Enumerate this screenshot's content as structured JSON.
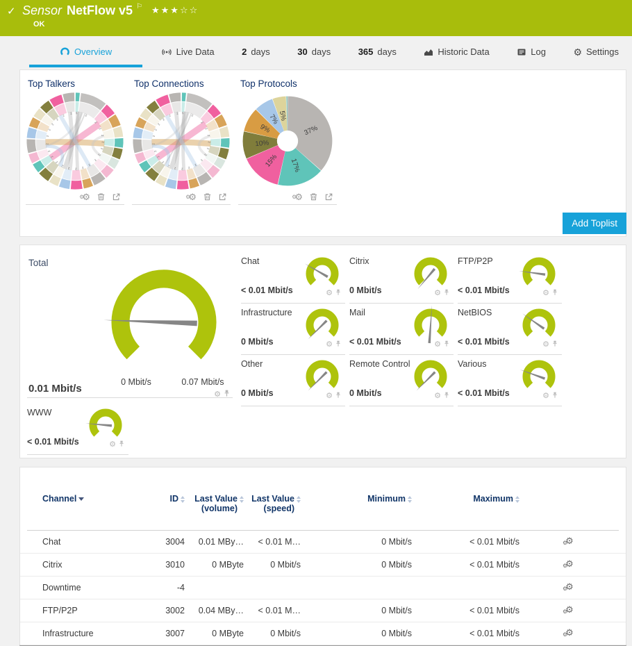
{
  "header": {
    "status_check_icon": "✓",
    "type_label": "Sensor",
    "sensor_name": "NetFlow v5",
    "flag_icon": "⚐",
    "rating_stars": "★★★☆☆",
    "status": "OK",
    "status_color": "#a8bd0c"
  },
  "tabs": [
    {
      "label": "Overview",
      "icon": "gauge-icon",
      "active": true
    },
    {
      "label": "Live Data",
      "icon": "live-data-icon"
    },
    {
      "num": "2",
      "label": "days"
    },
    {
      "num": "30",
      "label": "days"
    },
    {
      "num": "365",
      "label": "days"
    },
    {
      "label": "Historic Data",
      "icon": "area-chart-icon"
    },
    {
      "label": "Log",
      "icon": "log-icon"
    },
    {
      "label": "Settings",
      "icon": "gear-icon"
    }
  ],
  "toplists": {
    "add_button_label": "Add Toplist",
    "chart_action_icons": [
      "settings-gears-icon",
      "trash-icon",
      "open-external-icon"
    ]
  },
  "chart_data": {
    "toplist_charts": [
      {
        "title": "Top Talkers",
        "type": "chord"
      },
      {
        "title": "Top Connections",
        "type": "chord"
      },
      {
        "title": "Top Protocols",
        "type": "donut"
      }
    ],
    "ring_segments": [
      {
        "c": "#5fc4b9",
        "s": 0.5,
        "t": "5"
      },
      {
        "c": "#c2c0be",
        "s": 2.6,
        "t": "2"
      },
      {
        "c": "#f0609f",
        "s": 1.2,
        "t": "2"
      },
      {
        "c": "#d8a45a",
        "s": 1.2,
        "t": "2"
      },
      {
        "c": "#e9e2c6",
        "s": 1.1,
        "t": "2"
      },
      {
        "c": "#5fc4b9",
        "s": 1.0,
        "t": "2"
      },
      {
        "c": "#837f3e",
        "s": 1.1,
        "t": "2"
      },
      {
        "c": "#d9e6df",
        "s": 1.0,
        "t": "2"
      },
      {
        "c": "#f4b8d1",
        "s": 1.1,
        "t": "2"
      },
      {
        "c": "#b8b5b2",
        "s": 1.3,
        "t": "2"
      },
      {
        "c": "#d8a45a",
        "s": 1.0,
        "t": "2"
      },
      {
        "c": "#f0609f",
        "s": 1.2,
        "t": "2"
      },
      {
        "c": "#a7c7e8",
        "s": 1.1,
        "t": "2"
      },
      {
        "c": "#e9e2c6",
        "s": 1.0,
        "t": "2"
      },
      {
        "c": "#837f3e",
        "s": 1.2,
        "t": "2"
      },
      {
        "c": "#5fc4b9",
        "s": 1.0,
        "t": "2"
      },
      {
        "c": "#f4b8d1",
        "s": 1.0,
        "t": "2"
      },
      {
        "c": "#b8b5b2",
        "s": 1.4,
        "t": "2"
      },
      {
        "c": "#a7c7e8",
        "s": 1.1,
        "t": "2"
      },
      {
        "c": "#d8a45a",
        "s": 1.0,
        "t": "2"
      },
      {
        "c": "#e9e2c6",
        "s": 1.0,
        "t": "2"
      },
      {
        "c": "#837f3e",
        "s": 1.1,
        "t": "2"
      },
      {
        "c": "#f0609f",
        "s": 1.3,
        "t": "2"
      },
      {
        "c": "#b8b5b2",
        "s": 1.2,
        "t": "2"
      }
    ],
    "ring_chords": [
      {
        "a": 55,
        "b": 235,
        "c": "rgba(238,95,156,0.45)",
        "w": 10
      },
      {
        "a": 95,
        "b": 268,
        "c": "rgba(214,164,90,0.5)",
        "w": 9
      },
      {
        "a": 10,
        "b": 200,
        "c": "rgba(160,160,160,0.35)",
        "w": 7
      },
      {
        "a": 5,
        "b": 175,
        "c": "rgba(160,160,160,0.3)",
        "w": 5
      },
      {
        "a": 350,
        "b": 190,
        "c": "rgba(160,160,160,0.3)",
        "w": 6
      },
      {
        "a": 330,
        "b": 150,
        "c": "rgba(170,200,230,0.4)",
        "w": 6
      },
      {
        "a": 260,
        "b": 210,
        "c": "rgba(170,200,230,0.45)",
        "w": 5
      },
      {
        "a": 80,
        "b": 120,
        "c": "rgba(200,200,200,0.4)",
        "w": 4
      },
      {
        "a": 15,
        "b": 260,
        "c": "rgba(180,180,180,0.25)",
        "w": 3
      },
      {
        "a": 20,
        "b": 215,
        "c": "rgba(150,150,150,0.3)",
        "w": 2
      }
    ],
    "protocol_slices": [
      {
        "label": "37%",
        "pct": 36.5,
        "color": "#b8b5b2"
      },
      {
        "label": "17%",
        "pct": 17,
        "color": "#5fc4b9"
      },
      {
        "label": "15%",
        "pct": 15,
        "color": "#f0609f"
      },
      {
        "label": "10%",
        "pct": 10,
        "color": "#807d3b"
      },
      {
        "label": "9%",
        "pct": 9,
        "color": "#d89c43"
      },
      {
        "label": "7%",
        "pct": 7,
        "color": "#a7c7e8"
      },
      {
        "label": "5%",
        "pct": 5,
        "color": "#ddd49b"
      },
      {
        "label": "",
        "pct": 0.5,
        "color": "#6ab5ab"
      }
    ]
  },
  "gauges": {
    "accent_color": "#aec30c",
    "total": {
      "label": "Total",
      "value": "0.01 Mbit/s",
      "scale_min": "0 Mbit/s",
      "scale_max": "0.07 Mbit/s",
      "needle_deg": -88
    },
    "channels": [
      {
        "label": "Chat",
        "value": "< 0.01 Mbit/s",
        "needle_deg": -60
      },
      {
        "label": "Citrix",
        "value": "0 Mbit/s",
        "needle_deg": -140
      },
      {
        "label": "FTP/P2P",
        "value": "< 0.01 Mbit/s",
        "needle_deg": -82
      },
      {
        "label": "Infrastructure",
        "value": "0 Mbit/s",
        "needle_deg": -135
      },
      {
        "label": "Mail",
        "value": "< 0.01 Mbit/s",
        "needle_deg": 4,
        "tail": 26
      },
      {
        "label": "NetBIOS",
        "value": "< 0.01 Mbit/s",
        "needle_deg": -55
      },
      {
        "label": "Other",
        "value": "0 Mbit/s",
        "needle_deg": -135
      },
      {
        "label": "Remote Control",
        "value": "0 Mbit/s",
        "needle_deg": -135
      },
      {
        "label": "Various",
        "value": "< 0.01 Mbit/s",
        "needle_deg": -70
      }
    ],
    "www": {
      "label": "WWW",
      "value": "< 0.01 Mbit/s",
      "needle_deg": -85
    },
    "cell_action_icons": [
      "gear-icon",
      "pin-icon"
    ]
  },
  "table": {
    "columns": {
      "channel": "Channel",
      "id": "ID",
      "last_volume_1": "Last Value",
      "last_volume_2": "(volume)",
      "last_speed_1": "Last Value",
      "last_speed_2": "(speed)",
      "minimum": "Minimum",
      "maximum": "Maximum"
    },
    "rows": [
      {
        "channel": "Chat",
        "id": "3004",
        "volume": "0.01 MBy…",
        "speed": "< 0.01 M…",
        "min": "0 Mbit/s",
        "max": "< 0.01 Mbit/s"
      },
      {
        "channel": "Citrix",
        "id": "3010",
        "volume": "0 MByte",
        "speed": "0 Mbit/s",
        "min": "0 Mbit/s",
        "max": "< 0.01 Mbit/s"
      },
      {
        "channel": "Downtime",
        "id": "-4",
        "volume": "",
        "speed": "",
        "min": "",
        "max": ""
      },
      {
        "channel": "FTP/P2P",
        "id": "3002",
        "volume": "0.04 MBy…",
        "speed": "< 0.01 M…",
        "min": "0 Mbit/s",
        "max": "< 0.01 Mbit/s"
      },
      {
        "channel": "Infrastructure",
        "id": "3007",
        "volume": "0 MByte",
        "speed": "0 Mbit/s",
        "min": "0 Mbit/s",
        "max": "< 0.01 Mbit/s"
      }
    ]
  },
  "colors": {
    "accent_blue": "#17a2d9",
    "heading_navy": "#113568",
    "ok_green": "#a8bd0c"
  }
}
